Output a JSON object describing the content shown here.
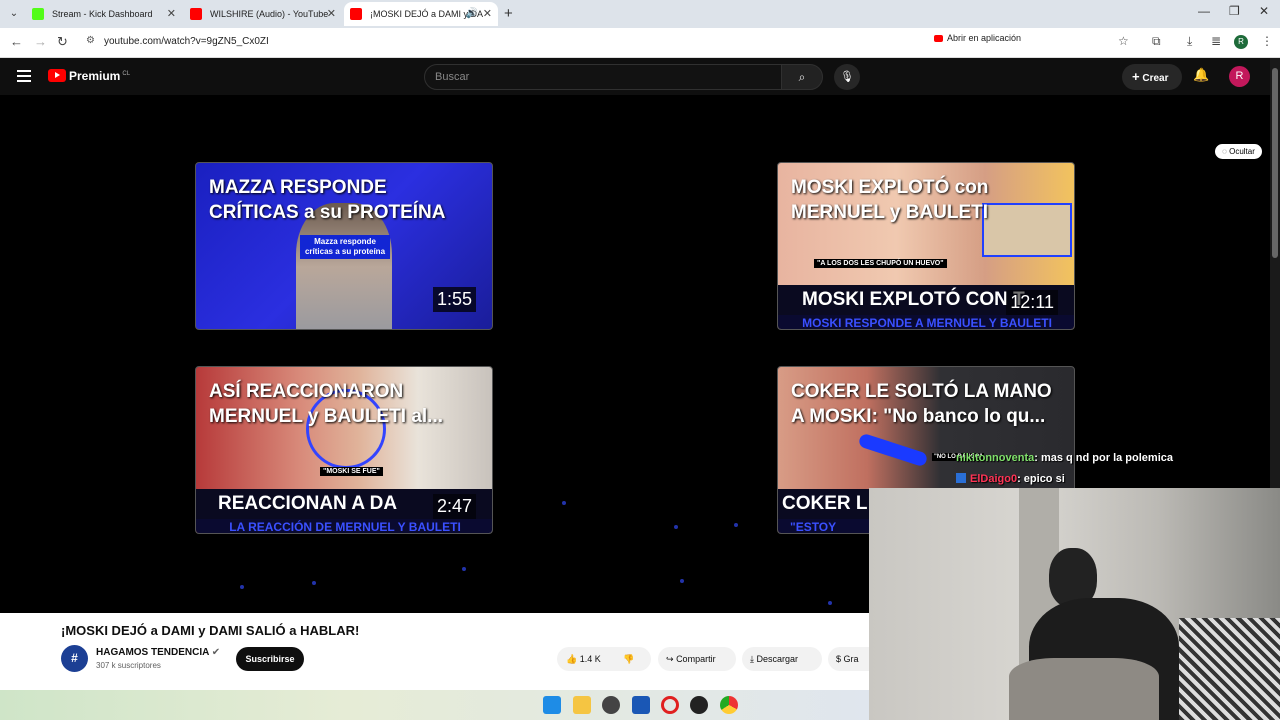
{
  "browser": {
    "tabs": [
      {
        "title": "Stream - Kick Dashboard",
        "favicon_color": "#53fc18"
      },
      {
        "title": "WILSHIRE (Audio) - YouTube",
        "favicon_color": "#ff0000"
      },
      {
        "title": "¡MOSKI DEJÓ a DAMI y DA",
        "favicon_color": "#ff0000"
      }
    ],
    "url": "youtube.com/watch?v=9gZN5_Cx0ZI",
    "open_in_app": "Abrir en aplicación",
    "profile_initial": "R"
  },
  "youtube": {
    "logo": "Premium",
    "region": "CL",
    "search_placeholder": "Buscar",
    "create_label": "Crear",
    "avatar_initial": "R"
  },
  "end_screen": {
    "hide_label": "Ocultar",
    "cards": [
      {
        "title": "MAZZA RESPONDE CRÍTICAS a su PROTEÍNA",
        "duration": "1:55",
        "inner_caption": "Mazza responde críticas a su proteína"
      },
      {
        "title": "MOSKI EXPLOTÓ con MERNUEL y BAULETI",
        "duration": "12:11",
        "band_top": "MOSKI EXPLOTÓ CON T",
        "band_bottom": "MOSKI RESPONDE A MERNUEL Y BAULETI",
        "caption": "\"A LOS DOS LES CHUPÓ UN HUEVO\""
      },
      {
        "title": "ASÍ REACCIONARON MERNUEL y BAULETI al...",
        "duration": "2:47",
        "band_top": "REACCIONAN A DA",
        "band_bottom": "LA REACCIÓN DE MERNUEL Y BAULETI",
        "caption": "\"MOSKI SE FUE\""
      },
      {
        "title": "COKER LE SOLTÓ LA MANO A MOSKI: \"No banco lo qu...",
        "band_top": "COKER L",
        "band_bottom": "\"ESTOY",
        "caption": "\"NO LO BANCO\""
      }
    ]
  },
  "video": {
    "title": "¡MOSKI DEJÓ a DAMI y DAMI SALIÓ a HABLAR!",
    "channel": "HAGAMOS TENDENCIA",
    "subscribers": "307 k suscriptores",
    "subscribe_label": "Suscribirse",
    "likes": "1.4 K",
    "share_label": "Compartir",
    "download_label": "Descargar",
    "thanks_label": "Gra"
  },
  "chat": [
    {
      "user": "nikitonnoventa",
      "user_color": "#7fe06a",
      "message": ": mas q nd por la polemica"
    },
    {
      "user": "ElDaigo0",
      "user_color": "#ff3355",
      "message": ": epico si"
    }
  ]
}
